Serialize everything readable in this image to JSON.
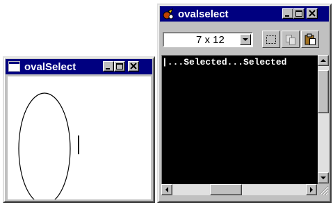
{
  "left_window": {
    "title": "ovalSelect",
    "icon": "window-icon",
    "controls": [
      "minimize-icon",
      "maximize-icon",
      "close-icon"
    ]
  },
  "right_window": {
    "title": "ovalselect",
    "icon": "app-icon",
    "controls": [
      "minimize-icon",
      "maximize-icon",
      "close-icon"
    ],
    "toolbar": {
      "font_size_value": "7 x 12",
      "buttons": [
        "mark-icon",
        "copy-icon",
        "paste-icon"
      ]
    },
    "console": {
      "text": "|...Selected...Selected"
    }
  }
}
